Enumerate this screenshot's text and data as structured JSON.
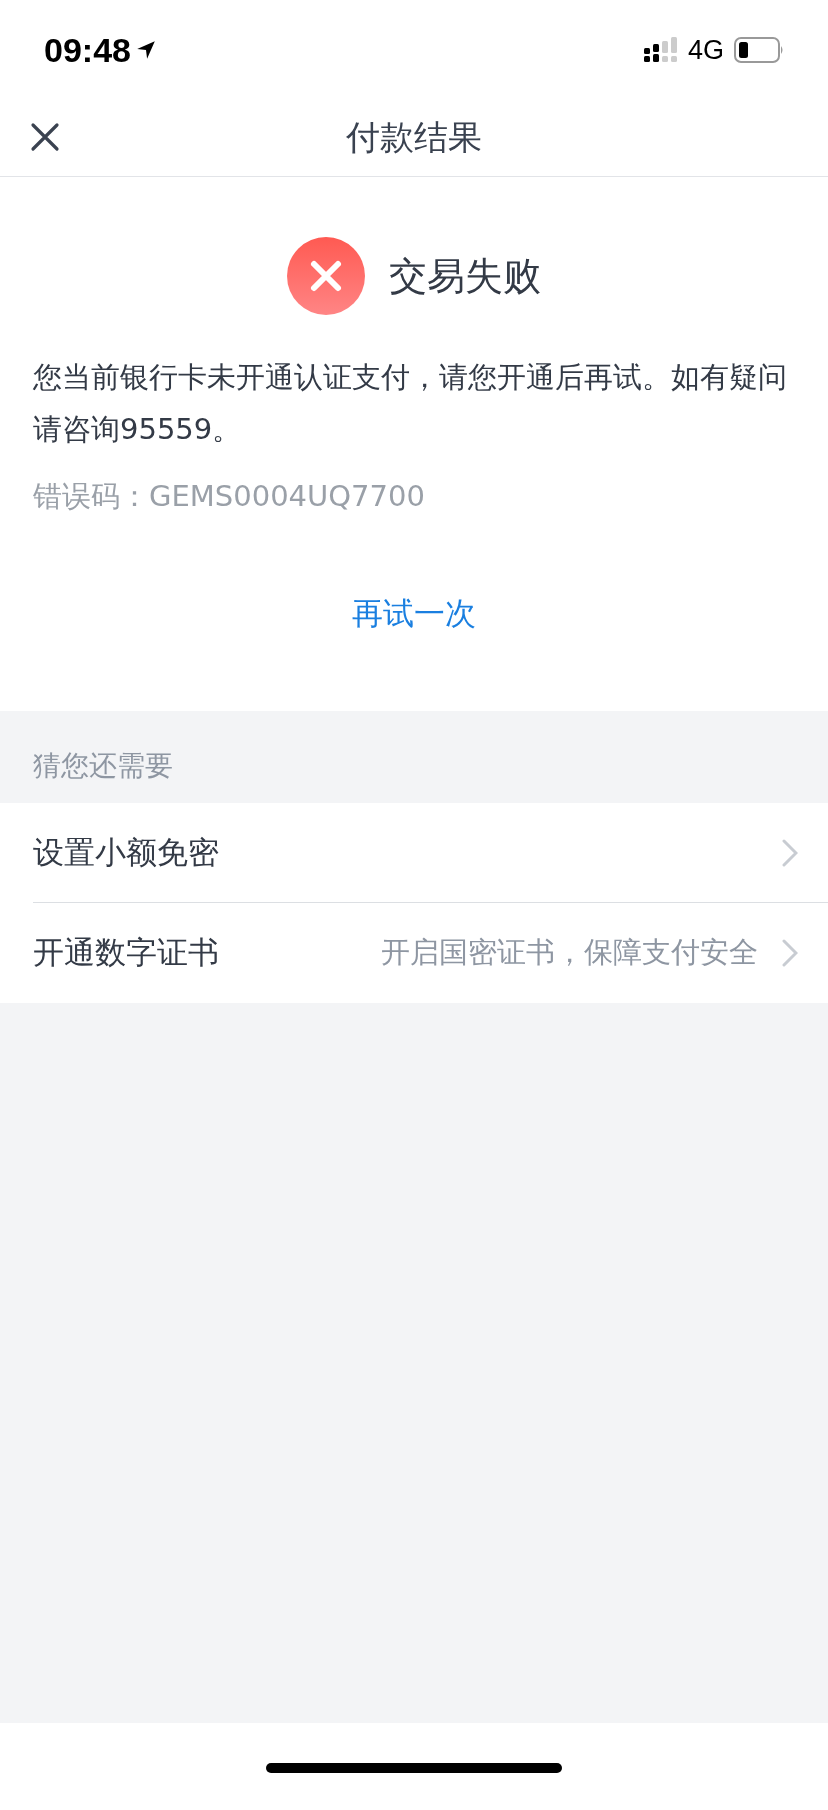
{
  "status_bar": {
    "time": "09:48",
    "network": "4G"
  },
  "nav": {
    "title": "付款结果"
  },
  "result": {
    "title": "交易失败",
    "message": "您当前银行卡未开通认证支付，请您开通后再试。如有疑问请咨询95559。",
    "error_code": "错误码：GEMS0004UQ7700",
    "retry": "再试一次"
  },
  "suggestions": {
    "header": "猜您还需要",
    "items": [
      {
        "label": "设置小额免密"
      },
      {
        "label": "开通数字证书",
        "hint": "开启国密证书，保障支付安全"
      }
    ]
  }
}
